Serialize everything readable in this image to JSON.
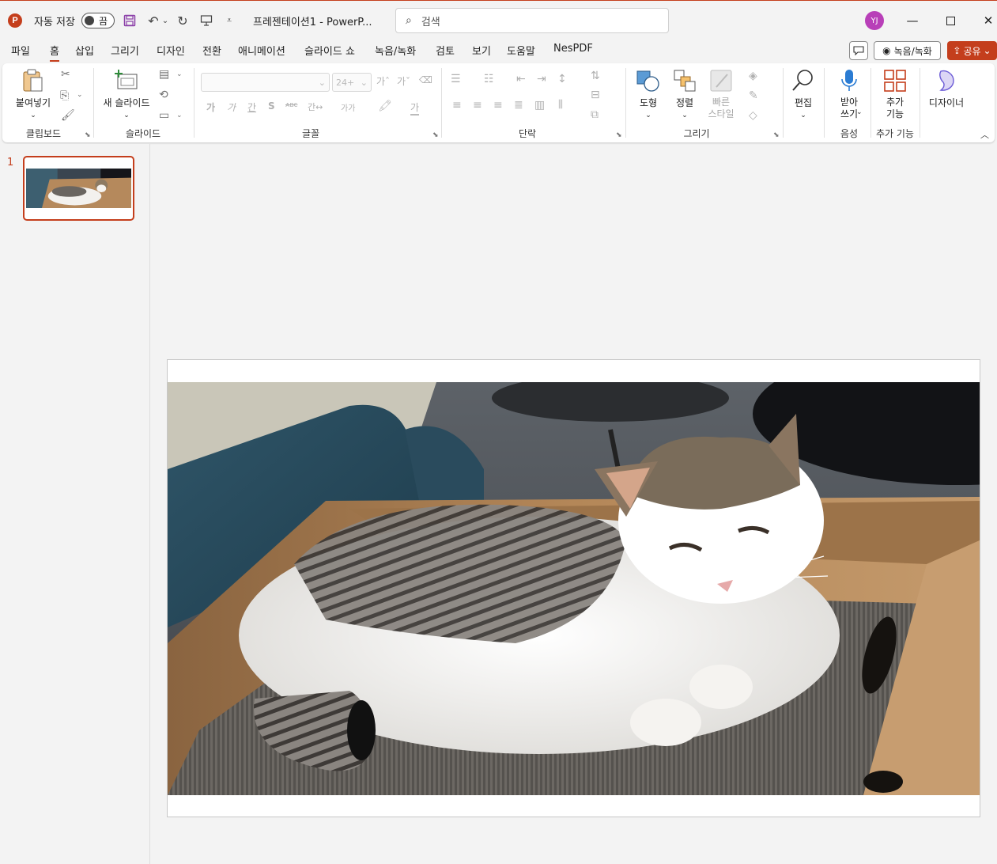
{
  "titlebar": {
    "autosave_label": "자동 저장",
    "autosave_state": "끔",
    "doc_title": "프레젠테이션1  -  PowerP...",
    "search_placeholder": "검색",
    "user_initials": "YJ"
  },
  "tabs": [
    "파일",
    "홈",
    "삽입",
    "그리기",
    "디자인",
    "전환",
    "애니메이션",
    "슬라이드 쇼",
    "녹음/녹화",
    "검토",
    "보기",
    "도움말",
    "NesPDF"
  ],
  "active_tab": "홈",
  "right_buttons": {
    "record": "녹음/녹화",
    "share": "공유"
  },
  "ribbon": {
    "clipboard": {
      "paste": "붙여넣기",
      "label": "클립보드"
    },
    "slides": {
      "new_slide": "새 슬라이드",
      "label": "슬라이드"
    },
    "font": {
      "font_name": "",
      "font_size": "24+",
      "label": "글꼴",
      "bold": "가",
      "italic": "가",
      "underline": "간",
      "shadow": "S",
      "strike": "ᴀʙᴄ",
      "spacing": "간↔",
      "case": "가가",
      "fontcolor": "가"
    },
    "paragraph": {
      "label": "단락"
    },
    "drawing": {
      "shape": "도형",
      "arrange": "정렬",
      "quick_style": "빠른\n스타일",
      "label": "그리기"
    },
    "editing": {
      "edit": "편집"
    },
    "voice": {
      "dictate": "받아\n쓰기",
      "label": "음성"
    },
    "addins": {
      "addins": "추가\n기능",
      "label": "추가 기능"
    },
    "designer": {
      "designer": "디자이너"
    }
  },
  "slides_pane": {
    "slide_number": "1"
  },
  "colors": {
    "accent": "#c43e1c",
    "avatar": "#b83fb8"
  }
}
